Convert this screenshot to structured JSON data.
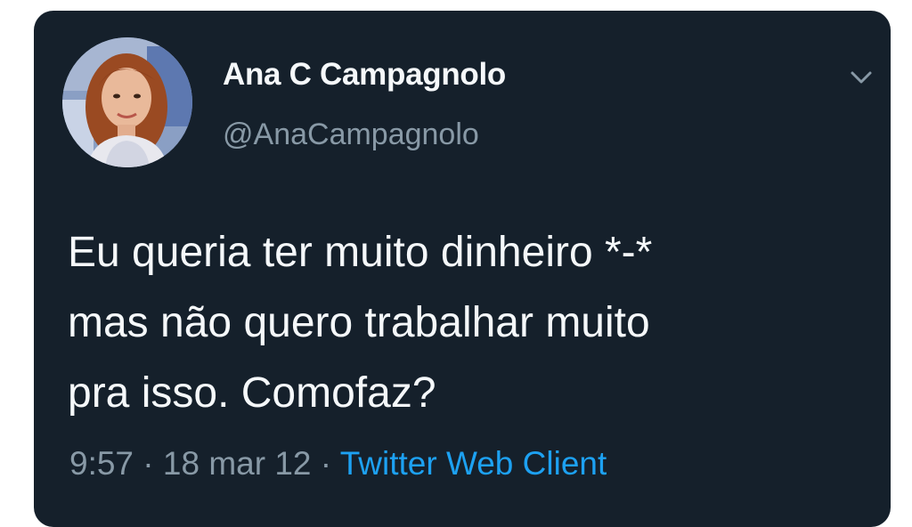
{
  "tweet": {
    "display_name": "Ana C Campagnolo",
    "handle": "@AnaCampagnolo",
    "text_lines": [
      "Eu queria ter muito dinheiro *-*",
      "mas não quero trabalhar muito",
      "pra isso. Comofaz?"
    ],
    "time": "9:57",
    "separator": "·",
    "date": "18 mar 12",
    "client": "Twitter Web Client"
  },
  "icons": {
    "menu": "chevron-down-icon",
    "avatar": "avatar-photo"
  },
  "colors": {
    "background": "#15202b",
    "text": "#f5f8fa",
    "secondary": "#8899a6",
    "link": "#1da1f2"
  }
}
